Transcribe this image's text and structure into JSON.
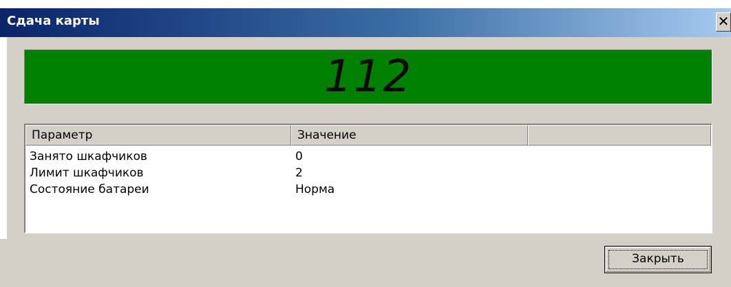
{
  "window": {
    "title": "Сдача карты",
    "close_glyph": "✕"
  },
  "display": {
    "value": "112",
    "background_color": "#008000"
  },
  "table": {
    "columns": [
      "Параметр",
      "Значение",
      ""
    ],
    "rows": [
      {
        "param": "Занято шкафчиков",
        "value": "0"
      },
      {
        "param": "Лимит шкафчиков",
        "value": "2"
      },
      {
        "param": "Состояние батареи",
        "value": "Норма"
      }
    ]
  },
  "buttons": {
    "close_label": "Закрыть"
  }
}
